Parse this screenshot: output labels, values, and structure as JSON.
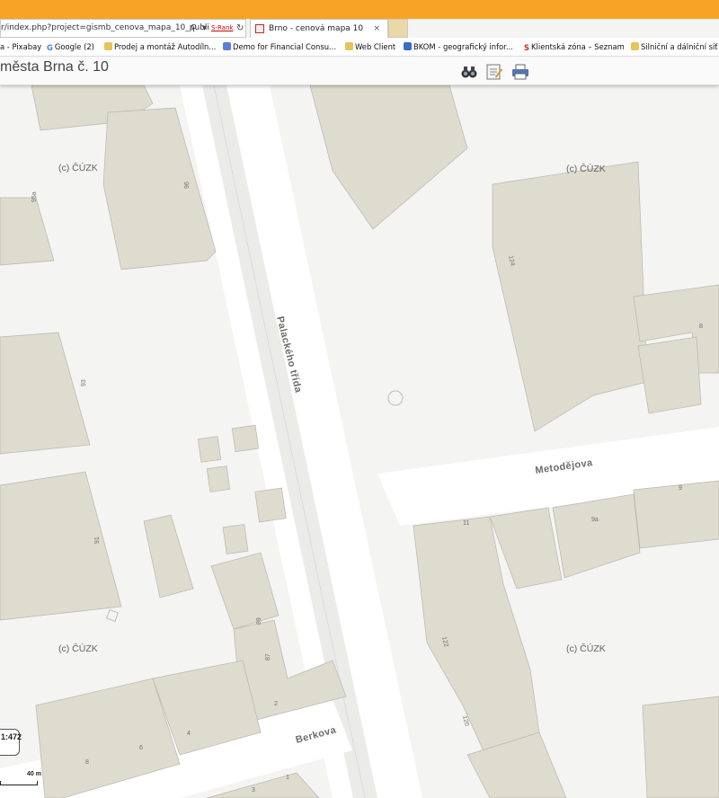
{
  "browser": {
    "url": "r/index.php?project=gismb_cenova_mapa_10_publi",
    "search_icon": "search-icon",
    "rank_label": "S-Rank",
    "refresh_icon": "refresh-icon",
    "tab": {
      "title": "Brno - cenová mapa 10",
      "close": "×"
    },
    "bookmarks": [
      {
        "label": "a - Pixabay",
        "icon": "none"
      },
      {
        "label": "Google (2)",
        "icon": "google-icon"
      },
      {
        "label": "Prodej a montáž Autodíln...",
        "icon": "ie-page-icon"
      },
      {
        "label": "Demo for Financial Consu...",
        "icon": "web-icon"
      },
      {
        "label": "Web Client",
        "icon": "ie-page-icon"
      },
      {
        "label": "BKOM - geografický infor...",
        "icon": "bkom-icon"
      },
      {
        "label": "Klientská zóna – Seznam",
        "icon": "seznam-icon"
      },
      {
        "label": "Silniční a dálniční síť",
        "icon": "ie-page-icon"
      }
    ]
  },
  "app": {
    "title": "města Brna č. 10",
    "tools": [
      "binoculars-icon",
      "legend-icon",
      "print-icon"
    ]
  },
  "map": {
    "watermark": "(c) ČÚZK",
    "streets": {
      "palackeho": "Palackého třída",
      "metodejova": "Metodějova",
      "berkova": "Berkova"
    },
    "house_numbers": {
      "n96": "96",
      "n95a": "95a",
      "n93": "93",
      "n91": "91",
      "n89": "89",
      "n87": "87",
      "n2": "2",
      "n4": "4",
      "n6": "6",
      "n8": "8",
      "n3": "3",
      "n1": "1",
      "n124": "124",
      "n8b": "8",
      "n11": "11",
      "n9a": "9a",
      "n9": "9",
      "n122": "122",
      "n120": "120"
    },
    "scale_text": "1:472",
    "scale_bar_label": "40 m"
  }
}
